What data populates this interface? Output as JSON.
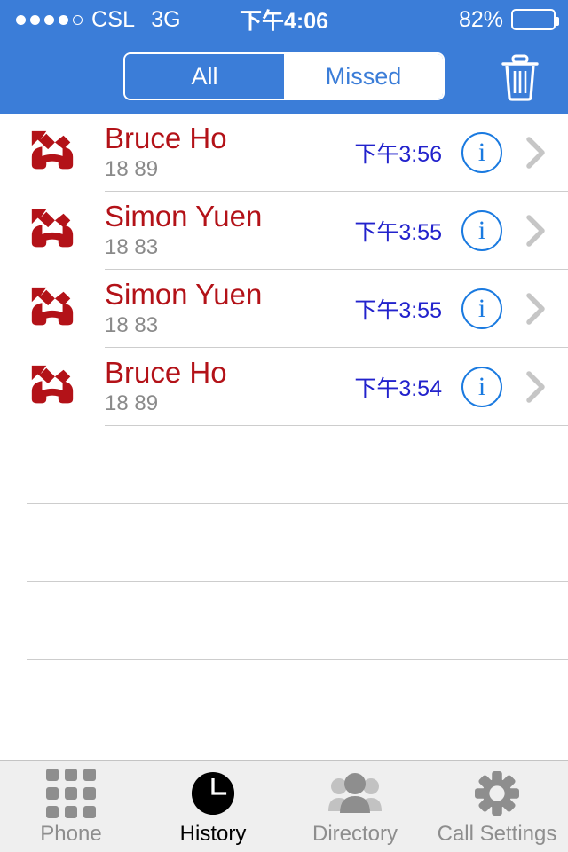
{
  "status_bar": {
    "signal_dots_filled": 4,
    "signal_dots_total": 5,
    "carrier": "CSL",
    "network": "3G",
    "time": "下午4:06",
    "battery_percent": "82%",
    "battery_level": 82
  },
  "nav_bar": {
    "segments": [
      {
        "label": "All",
        "selected": false
      },
      {
        "label": "Missed",
        "selected": true
      }
    ],
    "trash_icon": "trash-icon"
  },
  "calls": [
    {
      "icon": "missed-call-icon",
      "name": "Bruce Ho",
      "number": "18 89",
      "time": "下午3:56",
      "info": "i"
    },
    {
      "icon": "missed-call-icon",
      "name": "Simon Yuen",
      "number": "18 83",
      "time": "下午3:55",
      "info": "i"
    },
    {
      "icon": "missed-call-icon",
      "name": "Simon Yuen",
      "number": "18 83",
      "time": "下午3:55",
      "info": "i"
    },
    {
      "icon": "missed-call-icon",
      "name": "Bruce Ho",
      "number": "18 89",
      "time": "下午3:54",
      "info": "i"
    }
  ],
  "empty_row_count": 4,
  "tab_bar": {
    "tabs": [
      {
        "label": "Phone",
        "icon": "keypad-icon",
        "active": false
      },
      {
        "label": "History",
        "icon": "clock-icon",
        "active": true
      },
      {
        "label": "Directory",
        "icon": "people-icon",
        "active": false
      },
      {
        "label": "Call Settings",
        "icon": "gear-icon",
        "active": false
      }
    ]
  },
  "colors": {
    "nav_blue": "#3b7dd8",
    "missed_red": "#b31218",
    "time_blue": "#2222cc",
    "info_blue": "#1a7ae0",
    "number_gray": "#8a8a8a",
    "tabbar_bg": "#efefef",
    "tab_inactive": "#8e8e8e"
  }
}
